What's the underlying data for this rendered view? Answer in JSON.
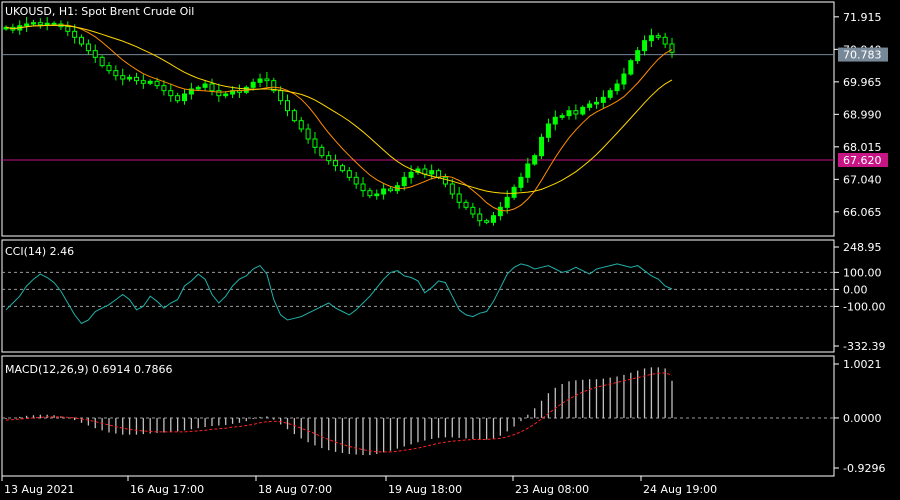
{
  "header": {
    "symbol_line": "UKOUSD, H1:  Spot Brent Crude Oil"
  },
  "colors": {
    "background": "#000000",
    "bull": "#00ff00",
    "ma_fast": "#ff8c00",
    "ma_slow": "#ffd700",
    "cci_line": "#20b2aa",
    "macd_hist": "#c0c0c0",
    "macd_signal": "#ff2020",
    "bid_line": "#778899",
    "alert_line": "#c71585",
    "grid": "#9a9a9a"
  },
  "time_axis": [
    "13 Aug 2021",
    "16 Aug 17:00",
    "18 Aug 07:00",
    "19 Aug 18:00",
    "23 Aug 08:00",
    "24 Aug 19:00"
  ],
  "chart_data": [
    {
      "type": "candlestick",
      "name": "price",
      "ylim": [
        65.4,
        72.3
      ],
      "yticks": [
        "71.915",
        "70.940",
        "69.965",
        "68.990",
        "68.015",
        "67.040",
        "66.065"
      ],
      "current_price": "70.783",
      "alert_price": "67.620",
      "close": [
        71.6,
        71.52,
        71.65,
        71.7,
        71.74,
        71.68,
        71.72,
        71.7,
        71.62,
        71.48,
        71.3,
        71.1,
        70.9,
        70.7,
        70.45,
        70.3,
        70.15,
        70.05,
        70.1,
        70.0,
        69.92,
        69.98,
        69.85,
        69.7,
        69.55,
        69.4,
        69.6,
        69.75,
        69.8,
        69.9,
        69.7,
        69.55,
        69.6,
        69.7,
        69.65,
        69.8,
        69.95,
        70.05,
        70.0,
        69.7,
        69.4,
        69.1,
        68.8,
        68.55,
        68.25,
        68.0,
        67.75,
        67.6,
        67.45,
        67.3,
        67.1,
        66.9,
        66.7,
        66.55,
        66.6,
        66.75,
        66.7,
        66.85,
        67.1,
        67.25,
        67.35,
        67.2,
        67.3,
        67.1,
        66.9,
        66.6,
        66.35,
        66.2,
        66.0,
        65.8,
        65.75,
        65.95,
        66.2,
        66.5,
        66.8,
        67.1,
        67.5,
        67.75,
        68.3,
        68.7,
        68.9,
        68.95,
        69.1,
        69.0,
        69.2,
        69.3,
        69.35,
        69.5,
        69.7,
        69.9,
        70.2,
        70.6,
        70.9,
        71.2,
        71.35,
        71.3,
        71.1,
        70.85
      ]
    },
    {
      "type": "line",
      "name": "CCI(14)",
      "value_label": "2.46",
      "ylim": [
        -332.39,
        248.95
      ],
      "yticks": [
        "248.95",
        "100.00",
        "0.00",
        "-100.00",
        "-332.39"
      ],
      "values": [
        -120,
        -80,
        -40,
        20,
        60,
        90,
        70,
        40,
        -10,
        -80,
        -150,
        -200,
        -180,
        -130,
        -110,
        -90,
        -60,
        -30,
        -60,
        -120,
        -100,
        -40,
        -70,
        -110,
        -80,
        -60,
        20,
        50,
        90,
        60,
        -30,
        -80,
        -40,
        20,
        60,
        80,
        120,
        140,
        90,
        -60,
        -150,
        -180,
        -170,
        -160,
        -140,
        -120,
        -100,
        -80,
        -110,
        -130,
        -150,
        -120,
        -80,
        -40,
        10,
        60,
        100,
        110,
        80,
        70,
        50,
        -20,
        10,
        50,
        40,
        -40,
        -120,
        -150,
        -160,
        -140,
        -130,
        -70,
        10,
        90,
        130,
        150,
        140,
        120,
        130,
        140,
        120,
        100,
        110,
        130,
        110,
        90,
        120,
        130,
        140,
        150,
        140,
        130,
        140,
        110,
        80,
        60,
        20,
        2.46
      ]
    },
    {
      "type": "histogram",
      "name": "MACD(12,26,9)",
      "value_label": "0.6914 0.7866",
      "ylim": [
        -0.9296,
        1.0021
      ],
      "yticks": [
        "1.0021",
        "0.0000",
        "-0.9296"
      ],
      "macd": [
        -0.02,
        0.0,
        0.02,
        0.04,
        0.05,
        0.06,
        0.06,
        0.05,
        0.03,
        0.0,
        -0.04,
        -0.09,
        -0.14,
        -0.19,
        -0.23,
        -0.27,
        -0.29,
        -0.31,
        -0.31,
        -0.31,
        -0.3,
        -0.29,
        -0.28,
        -0.27,
        -0.26,
        -0.25,
        -0.23,
        -0.21,
        -0.19,
        -0.17,
        -0.15,
        -0.14,
        -0.13,
        -0.11,
        -0.09,
        -0.06,
        -0.02,
        0.02,
        0.03,
        -0.03,
        -0.12,
        -0.21,
        -0.3,
        -0.38,
        -0.45,
        -0.51,
        -0.56,
        -0.6,
        -0.63,
        -0.65,
        -0.67,
        -0.68,
        -0.69,
        -0.69,
        -0.67,
        -0.64,
        -0.61,
        -0.57,
        -0.53,
        -0.49,
        -0.45,
        -0.42,
        -0.39,
        -0.37,
        -0.36,
        -0.36,
        -0.37,
        -0.38,
        -0.39,
        -0.4,
        -0.4,
        -0.38,
        -0.33,
        -0.25,
        -0.16,
        -0.06,
        0.06,
        0.18,
        0.32,
        0.46,
        0.56,
        0.63,
        0.68,
        0.7,
        0.71,
        0.72,
        0.72,
        0.73,
        0.75,
        0.77,
        0.8,
        0.84,
        0.88,
        0.92,
        0.94,
        0.94,
        0.92,
        0.69
      ],
      "signal": [
        -0.04,
        -0.03,
        -0.02,
        -0.01,
        0.0,
        0.01,
        0.02,
        0.02,
        0.02,
        0.01,
        0.0,
        -0.02,
        -0.04,
        -0.07,
        -0.1,
        -0.13,
        -0.16,
        -0.19,
        -0.21,
        -0.23,
        -0.24,
        -0.25,
        -0.26,
        -0.26,
        -0.26,
        -0.26,
        -0.26,
        -0.25,
        -0.24,
        -0.23,
        -0.21,
        -0.2,
        -0.19,
        -0.17,
        -0.16,
        -0.14,
        -0.12,
        -0.09,
        -0.07,
        -0.06,
        -0.07,
        -0.1,
        -0.14,
        -0.19,
        -0.24,
        -0.29,
        -0.35,
        -0.4,
        -0.45,
        -0.49,
        -0.53,
        -0.56,
        -0.59,
        -0.61,
        -0.63,
        -0.63,
        -0.63,
        -0.62,
        -0.6,
        -0.58,
        -0.56,
        -0.53,
        -0.5,
        -0.47,
        -0.45,
        -0.43,
        -0.42,
        -0.41,
        -0.4,
        -0.4,
        -0.4,
        -0.39,
        -0.38,
        -0.35,
        -0.31,
        -0.26,
        -0.19,
        -0.11,
        -0.02,
        0.08,
        0.18,
        0.27,
        0.35,
        0.42,
        0.48,
        0.53,
        0.57,
        0.6,
        0.63,
        0.66,
        0.69,
        0.72,
        0.75,
        0.78,
        0.81,
        0.83,
        0.84,
        0.79
      ]
    }
  ]
}
